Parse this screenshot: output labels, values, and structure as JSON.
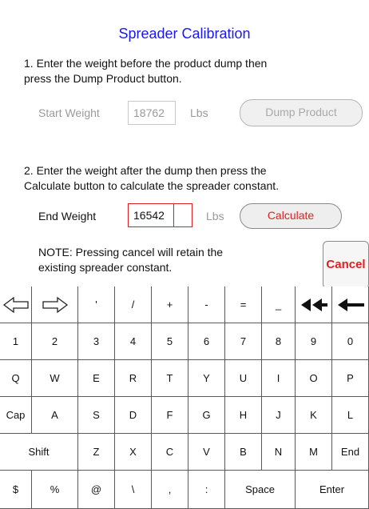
{
  "title": "Spreader Calibration",
  "step1": {
    "line1": "1. Enter the weight before the product dump then",
    "line2": "press the Dump Product button."
  },
  "start": {
    "label": "Start Weight",
    "value": "18762",
    "unit": "Lbs",
    "button": "Dump Product"
  },
  "step2": {
    "line1": "2. Enter the weight after the dump then press the",
    "line2": "Calculate button to calculate the spreader constant."
  },
  "end": {
    "label": "End Weight",
    "value": "16542",
    "unit": "Lbs",
    "button": "Calculate"
  },
  "note": {
    "line1": "NOTE: Pressing cancel will retain the",
    "line2": "existing spreader constant."
  },
  "cancel": "Cancel",
  "keyboard": {
    "row0": [
      "left-arrow-icon",
      "right-arrow-icon",
      "'",
      "/",
      "+",
      "-",
      "=",
      "_",
      "double-backspace-icon",
      "backspace-icon"
    ],
    "row1": [
      "1",
      "2",
      "3",
      "4",
      "5",
      "6",
      "7",
      "8",
      "9",
      "0"
    ],
    "row2": [
      "Q",
      "W",
      "E",
      "R",
      "T",
      "Y",
      "U",
      "I",
      "O",
      "P"
    ],
    "row3": [
      "Cap",
      "A",
      "S",
      "D",
      "F",
      "G",
      "H",
      "J",
      "K",
      "L"
    ],
    "row4": [
      "Shift",
      "Z",
      "X",
      "C",
      "V",
      "B",
      "N",
      "M",
      "End"
    ],
    "row5": [
      "$",
      "%",
      "@",
      "\\",
      ",",
      ":",
      "Space",
      "Enter"
    ]
  },
  "colors": {
    "title": "#1a1ae6",
    "accent_red": "#e02020",
    "disabled": "#9a9a9a"
  }
}
